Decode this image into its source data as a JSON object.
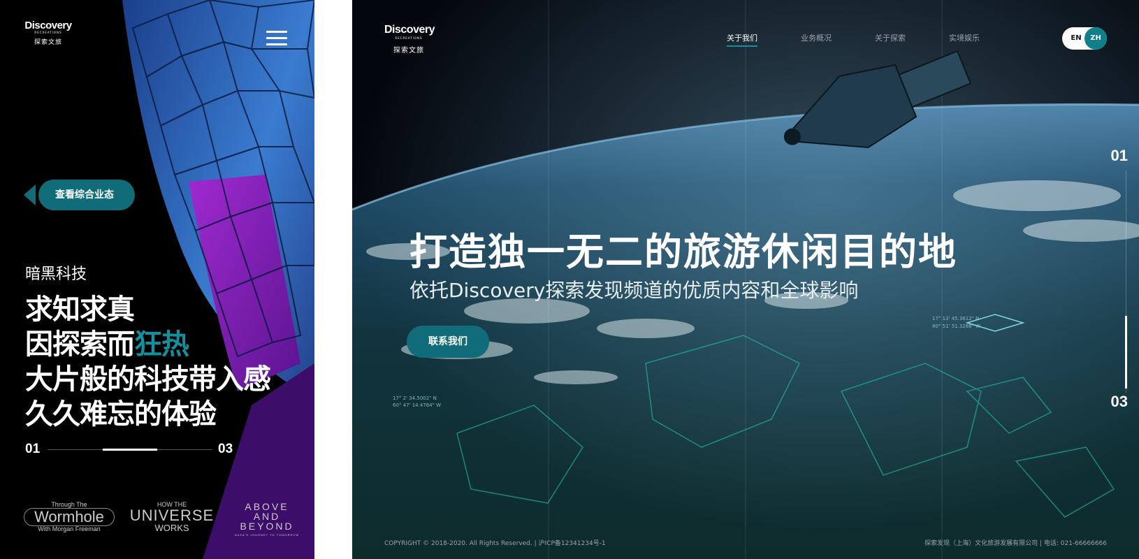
{
  "mobile": {
    "logo": {
      "wordmark": "Discovery",
      "sub": "RECREATIONS",
      "cn": "探索文旅"
    },
    "cta_label": "查看综合业态",
    "category": "暗黑科技",
    "headline": {
      "line1": "求知求真",
      "line2_pre": "因探索而",
      "line2_accent": "狂热",
      "line3": "大片般的科技带入感",
      "line4": "久久难忘的体验"
    },
    "pager": {
      "current": "01",
      "total": "03",
      "progress": 0.5
    },
    "brands": {
      "wormhole_small": "Through The",
      "wormhole_big": "Wormhole",
      "wormhole_sub": "With Morgan Freeman",
      "universe_top": "HOW THE",
      "universe_mid": "UNIVERSE",
      "universe_bottom": "WORKS",
      "above_line1": "ABOVE AND",
      "above_line2": "BEYOND",
      "above_tagline": "NASA'S JOURNEY TO TOMORROW"
    },
    "colors": {
      "accent": "#14909c",
      "button": "#0f6c78"
    }
  },
  "desktop": {
    "logo": {
      "wordmark": "Discovery",
      "sub": "RECREATIONS",
      "cn": "探索文旅"
    },
    "nav": [
      {
        "label": "关于我们",
        "active": true
      },
      {
        "label": "业务概况",
        "active": false
      },
      {
        "label": "关于探索",
        "active": false
      },
      {
        "label": "实境娱乐",
        "active": false
      }
    ],
    "lang": {
      "en": "EN",
      "zh": "ZH",
      "selected": "ZH"
    },
    "hero": {
      "title": "打造独一无二的旅游休闲目的地",
      "subtitle": "依托Discovery探索发现频道的优质内容和全球影响",
      "button": "联系我们"
    },
    "pager": {
      "current": "01",
      "total": "03",
      "progress": 1.0
    },
    "map_coords": [
      "17° 13' 45.3612\" N",
      "80° 51' 51.3288\" W",
      "17° 2' 34.5002\" N",
      "60° 47' 14.4764\" W"
    ],
    "footer": {
      "copyright": "COPYRIGHT © 2018-2020. All Rights Reserved. | 沪ICP备12341234号-1",
      "company": "探索发现（上海）文化旅游发展有限公司 | 电话: 021-66666666"
    }
  }
}
